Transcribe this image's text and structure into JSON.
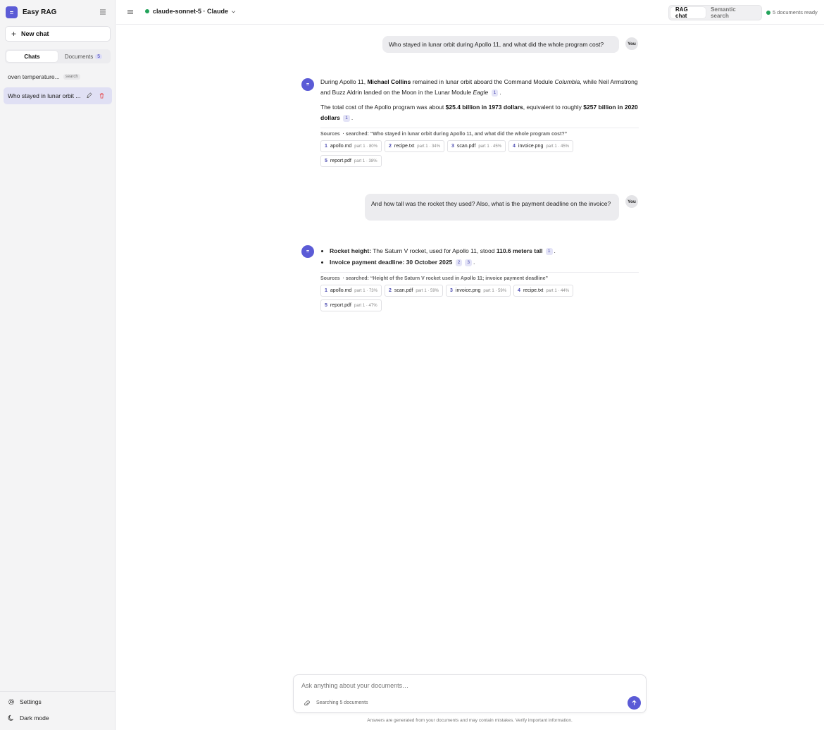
{
  "app": {
    "logo_text": "=",
    "name": "Easy RAG"
  },
  "sidebar": {
    "new_chat_label": "New chat",
    "tabs": [
      {
        "label": "Chats"
      },
      {
        "label": "Documents",
        "count": "5"
      }
    ],
    "chats": [
      {
        "title": "oven temperature...",
        "tag": "search"
      },
      {
        "title": "Who stayed in lunar orbit ..."
      }
    ],
    "settings_label": "Settings",
    "dark_mode_label": "Dark mode"
  },
  "topbar": {
    "model_label": "claude-sonnet-5 · Claude",
    "modes": [
      "RAG chat",
      "Semantic search"
    ],
    "status": "5 documents ready"
  },
  "conversation": {
    "user_badge": "You",
    "bot_avatar": "=",
    "q1": "Who stayed in lunar orbit during Apollo 11, and what did the whole program cost?",
    "a1": {
      "p1": {
        "t1": "During Apollo 11, ",
        "b1": "Michael Collins",
        "t2": " remained in lunar orbit aboard the Command Module ",
        "i1": "Columbia",
        "t3": ", while Neil Armstrong and Buzz Aldrin landed on the Moon in the Lunar Module ",
        "i2": "Eagle",
        "cite": "1",
        "end": "."
      },
      "p2": {
        "t1": "The total cost of the Apollo program was about ",
        "b1": "$25.4 billion in 1973 dollars",
        "t2": ", equivalent to roughly ",
        "b2": "$257 billion in 2020 dollars",
        "cite": "1",
        "end": "."
      },
      "sources_label": "Sources",
      "searched": "· searched: “Who stayed in lunar orbit during Apollo 11, and what did the whole program cost?”",
      "sources": [
        {
          "n": "1",
          "file": "apollo.md",
          "meta": "part 1 · 80%"
        },
        {
          "n": "2",
          "file": "recipe.txt",
          "meta": "part 1 · 34%"
        },
        {
          "n": "3",
          "file": "scan.pdf",
          "meta": "part 1 · 45%"
        },
        {
          "n": "4",
          "file": "invoice.png",
          "meta": "part 1 · 45%"
        },
        {
          "n": "5",
          "file": "report.pdf",
          "meta": "part 1 · 38%"
        }
      ]
    },
    "q2": "And how tall was the rocket they used? Also, what is the payment deadline on the invoice?",
    "a2": {
      "li1": {
        "b1": "Rocket height:",
        "t1": " The Saturn V rocket, used for Apollo 11, stood ",
        "b2": "110.6 meters tall",
        "cite": "1",
        "end": "."
      },
      "li2": {
        "b1": "Invoice payment deadline: 30 October 2025",
        "cite1": "2",
        "cite2": "3",
        "end": "."
      },
      "sources_label": "Sources",
      "searched": "· searched: “Height of the Saturn V rocket used in Apollo 11; invoice payment deadline”",
      "sources": [
        {
          "n": "1",
          "file": "apollo.md",
          "meta": "part 1 · 73%"
        },
        {
          "n": "2",
          "file": "scan.pdf",
          "meta": "part 1 · 59%"
        },
        {
          "n": "3",
          "file": "invoice.png",
          "meta": "part 1 · 59%"
        },
        {
          "n": "4",
          "file": "recipe.txt",
          "meta": "part 1 · 44%"
        },
        {
          "n": "5",
          "file": "report.pdf",
          "meta": "part 1 · 47%"
        }
      ]
    }
  },
  "composer": {
    "placeholder": "Ask anything about your documents…",
    "status": "Searching 5 documents",
    "disclaimer": "Answers are generated from your documents and may contain mistakes. Verify important information."
  },
  "colors": {
    "accent": "#5b5bd6",
    "status_green": "#22a35a",
    "delete_red": "#e5484d"
  }
}
